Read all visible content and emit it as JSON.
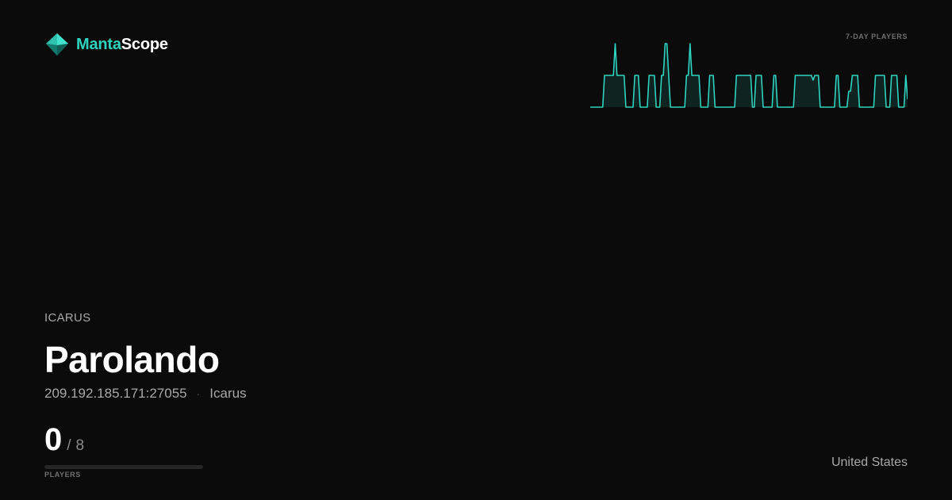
{
  "brand": {
    "accent_part": "Manta",
    "rest_part": "Scope",
    "icon": "manta-gem-icon",
    "accent_color": "#2ed3bf"
  },
  "sparkline": {
    "label": "7-DAY PLAYERS",
    "values": [
      0,
      0,
      0,
      0,
      0,
      0,
      0,
      0,
      1,
      1,
      1,
      1,
      1,
      1,
      2,
      1,
      1,
      1,
      1,
      1,
      0,
      0,
      0,
      0,
      0,
      1,
      1,
      1,
      0,
      0,
      0,
      0,
      0,
      1,
      1,
      1,
      1,
      0,
      0,
      0,
      1,
      1,
      2,
      2,
      1,
      0,
      0,
      0,
      0,
      0,
      0,
      0,
      0,
      0,
      1,
      1,
      2,
      1,
      1,
      1,
      1,
      1,
      0,
      0,
      0,
      0,
      0,
      1,
      1,
      1,
      0,
      0,
      0,
      0,
      0,
      0,
      0,
      0,
      0,
      0,
      0,
      0,
      1,
      1,
      1,
      1,
      1,
      1,
      1,
      1,
      1,
      0,
      0,
      1,
      1,
      1,
      1,
      0,
      0,
      0,
      0,
      0,
      0,
      1,
      1,
      0,
      0,
      0,
      0,
      0,
      0,
      0,
      0,
      0,
      0,
      1,
      1,
      1,
      1,
      1,
      1,
      1,
      1,
      1,
      1,
      0.85,
      1,
      1,
      1,
      0,
      0,
      0,
      0,
      0,
      0,
      0,
      0,
      0,
      1,
      1,
      0,
      0,
      0,
      0,
      0,
      0.5,
      0.5,
      1,
      1,
      1,
      1,
      0,
      0,
      0,
      0,
      0,
      0,
      0,
      0,
      0,
      1,
      1,
      1,
      1,
      1,
      1,
      0,
      0,
      0,
      1,
      1,
      1,
      1,
      0,
      0,
      0,
      0,
      1,
      0.25
    ]
  },
  "server": {
    "game_tag": "ICARUS",
    "name": "Parolando",
    "address": "209.192.185.171:27055",
    "separator": "·",
    "game": "Icarus",
    "players_now": "0",
    "players_sep": "/",
    "players_max": "8",
    "players_label": "PLAYERS",
    "fill_fraction": 0,
    "country": "United States"
  }
}
